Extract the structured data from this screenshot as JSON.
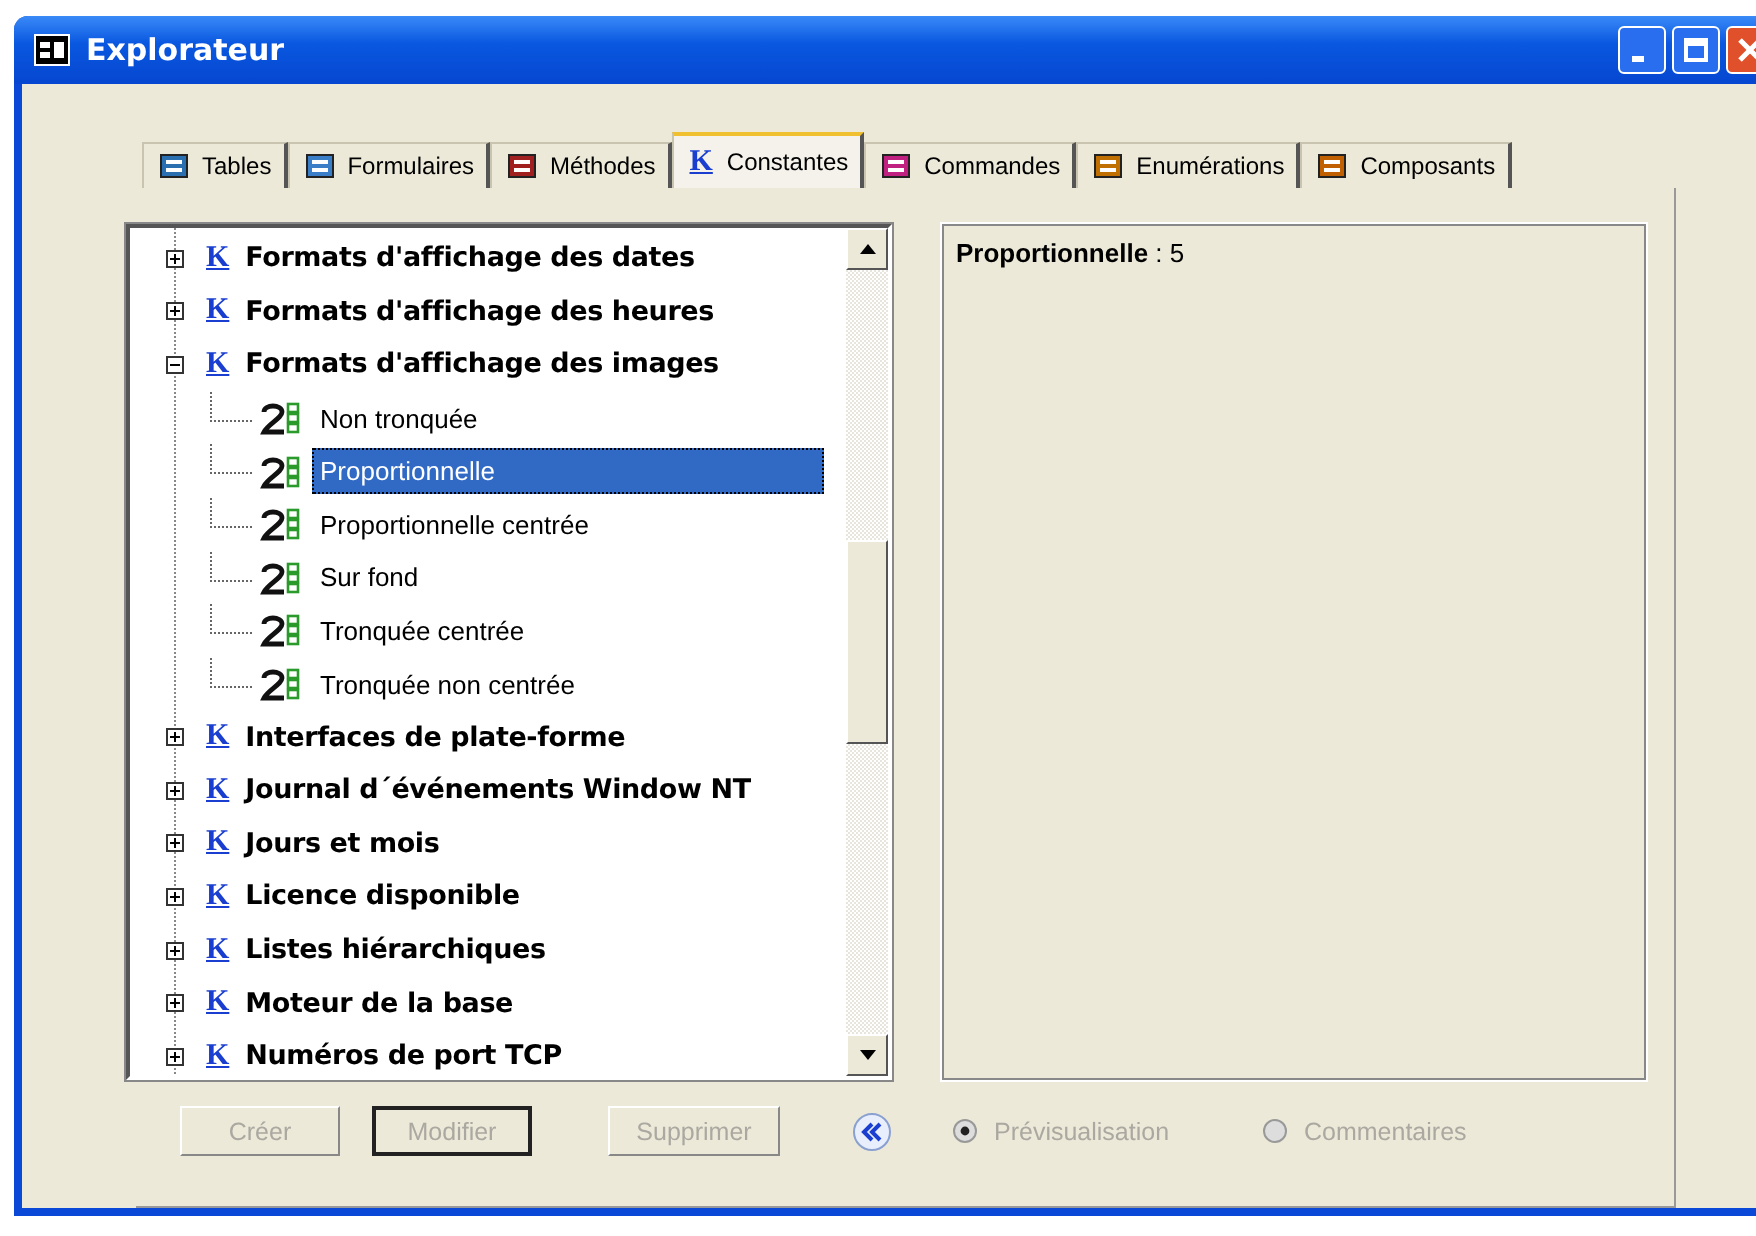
{
  "window": {
    "title": "Explorateur"
  },
  "tabs": [
    {
      "label": "Tables",
      "selected": false
    },
    {
      "label": "Formulaires",
      "selected": false
    },
    {
      "label": "Méthodes",
      "selected": false
    },
    {
      "label": "Constantes",
      "selected": true,
      "icon": "K"
    },
    {
      "label": "Commandes",
      "selected": false
    },
    {
      "label": "Enumérations",
      "selected": false
    },
    {
      "label": "Composants",
      "selected": false
    }
  ],
  "tree": [
    {
      "icon": "K",
      "label": "Formats d'affichage des dates",
      "expanded": false
    },
    {
      "icon": "K",
      "label": "Formats d'affichage des heures",
      "expanded": false
    },
    {
      "icon": "K",
      "label": "Formats d'affichage des images",
      "expanded": true,
      "children": [
        {
          "label": "Non tronquée",
          "selected": false
        },
        {
          "label": "Proportionnelle",
          "selected": true
        },
        {
          "label": "Proportionnelle centrée",
          "selected": false
        },
        {
          "label": "Sur fond",
          "selected": false
        },
        {
          "label": "Tronquée centrée",
          "selected": false
        },
        {
          "label": "Tronquée non centrée",
          "selected": false
        }
      ]
    },
    {
      "icon": "K",
      "label": "Interfaces de plate-forme",
      "expanded": false
    },
    {
      "icon": "K",
      "label": "Journal d´événements Window NT",
      "expanded": false
    },
    {
      "icon": "K",
      "label": "Jours et mois",
      "expanded": false
    },
    {
      "icon": "K",
      "label": "Licence disponible",
      "expanded": false
    },
    {
      "icon": "K",
      "label": "Listes hiérarchiques",
      "expanded": false
    },
    {
      "icon": "K",
      "label": "Moteur de la base",
      "expanded": false
    },
    {
      "icon": "K",
      "label": "Numéros de port TCP",
      "expanded": false
    }
  ],
  "preview": "**Proportionnelle** : 5",
  "buttons": [
    {
      "label": "Créer",
      "disabled": true,
      "default": false
    },
    {
      "label": "Modifier",
      "disabled": true,
      "default": true
    },
    {
      "label": "Supprimer",
      "disabled": true,
      "default": false
    }
  ],
  "radios": [
    {
      "label": "Prévisualisation",
      "selected": true,
      "disabled": true
    },
    {
      "label": "Commentaires",
      "selected": false,
      "disabled": true
    }
  ]
}
